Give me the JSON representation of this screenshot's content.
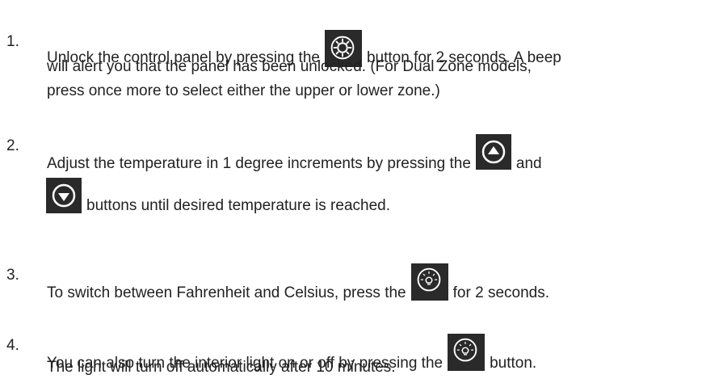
{
  "steps": [
    {
      "number": "1.",
      "line1_before": "Unlock the control panel by pressing the",
      "line1_icon": "gear-icon",
      "line1_after": "button for 2 seconds. A beep",
      "line2": "will alert you that the panel has been unlocked. (For Dual Zone models,",
      "line3": "press once more to select either the upper or lower zone.)"
    },
    {
      "number": "2.",
      "line1_before": "Adjust the temperature in 1 degree increments by pressing the",
      "line1_icon": "arrow-up-icon",
      "line1_after": "and",
      "line2_icon": "arrow-down-icon",
      "line2_after": "buttons until desired temperature is reached."
    },
    {
      "number": "3.",
      "line1_before": "To switch between Fahrenheit and Celsius, press the",
      "line1_icon": "light-icon",
      "line1_after": "for 2 seconds."
    },
    {
      "number": "4.",
      "line1_before": "You can also turn the interior light on or off by pressing the",
      "line1_icon": "light-icon",
      "line1_after": "button.",
      "line2": "The light will turn off automatically after 10 minutes."
    }
  ],
  "colors": {
    "text": "#222222",
    "icon_bg": "#2a2a2a",
    "icon_fg": "#ffffff"
  }
}
